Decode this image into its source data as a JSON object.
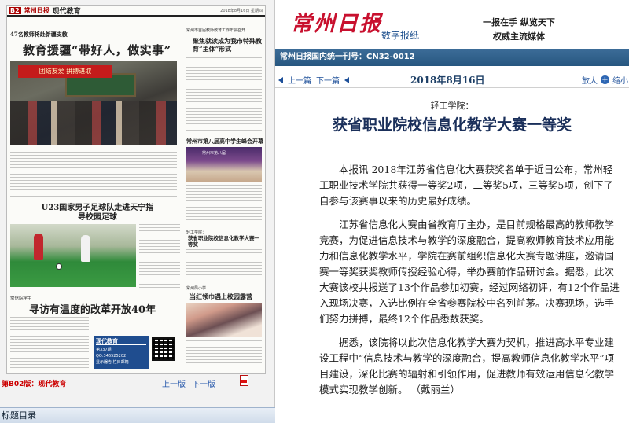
{
  "left_pane": {
    "page_header": {
      "code": "B2",
      "masthead": "常州日报",
      "section": "现代教育",
      "date": "2018年8月16日 星期四"
    },
    "articles": [
      {
        "kicker": "47名教师将赴新疆支教",
        "headline": "教育援疆“带好人，做实事”",
        "photo_banner": "团结友爱 拼搏进取"
      },
      {
        "kicker": "常州市首届教师教育工作年会召开",
        "headline": "聚焦就读成为我市特殊教育“主体”形式"
      },
      {
        "headline": "常州市第八届高中学生峰会开幕",
        "photo_caption": "常州市第八届"
      },
      {
        "headline": "U23国家男子足球队走进天宁指导校园足球"
      },
      {
        "kicker": "常信院学生",
        "headline": "寻访有温度的改革开放40年"
      },
      {
        "kicker": "轻工学院：",
        "headline": "获省职业院校信息化教学大赛一等奖"
      },
      {
        "kicker": "常州局小学",
        "headline": "当红领巾遇上校园露营"
      }
    ],
    "ad": {
      "title": "现代教育",
      "line1": "第337期",
      "line2": "QQ:346525202",
      "line3": "显示器告·栏目邮箱"
    },
    "edition_label": "第B02版：现代教育",
    "nav": {
      "prev": "上一版",
      "next": "下一版"
    },
    "toc_label": "标题目录"
  },
  "right_pane": {
    "logo": "常州日报",
    "brand_sub": "数字报纸",
    "slogan_line1": "一报在手 纵览天下",
    "slogan_line2": "权威主流媒体",
    "issn": "常州日报国内统一刊号：CN32-0012",
    "nav": {
      "prev_article": "上一篇",
      "next_article": "下一篇",
      "date": "2018年8月16日",
      "zoom_in": "放大",
      "zoom_out": "缩小"
    },
    "article": {
      "kicker": "轻工学院：",
      "headline": "获省职业院校信息化教学大赛一等奖",
      "paragraphs": [
        "本报讯 2018年江苏省信息化大赛获奖名单于近日公布，常州轻工职业技术学院共获得一等奖2项，二等奖5项，三等奖5项，创下了自参与该赛事以来的历史最好成绩。",
        "江苏省信息化大赛由省教育厅主办，是目前规格最高的教师教学竞赛，为促进信息技术与教学的深度融合，提高教师教育技术应用能力和信息化教学水平，学院在赛前组织信息化大赛专题讲座，邀请国赛一等奖获奖教师传授经验心得，举办赛前作品研讨会。据悉，此次大赛该校共报送了13个作品参加初赛，经过网络初评，有12个作品进入现场决赛，入选比例在全省参赛院校中名列前茅。决赛现场，选手们努力拼搏，最终12个作品悉数获奖。",
        "据悉，该院将以此次信息化教学大赛为契机，推进高水平专业建设工程中“信息技术与教学的深度融合，提高教师信息化教学水平”项目建设，深化比赛的辐射和引领作用，促进教师有效运用信息化教学模式实现教学创新。 （戴丽兰）"
      ]
    },
    "bottom_peek": "，  ，  ，"
  },
  "colors": {
    "brand_red": "#c8102e",
    "link_blue": "#1d4f99",
    "issn_bar": "#275780",
    "headline_navy": "#1a2f5a"
  },
  "icons": [
    "pdf-icon",
    "triangle-left-icon",
    "zoom-in-icon",
    "zoom-out-icon"
  ]
}
